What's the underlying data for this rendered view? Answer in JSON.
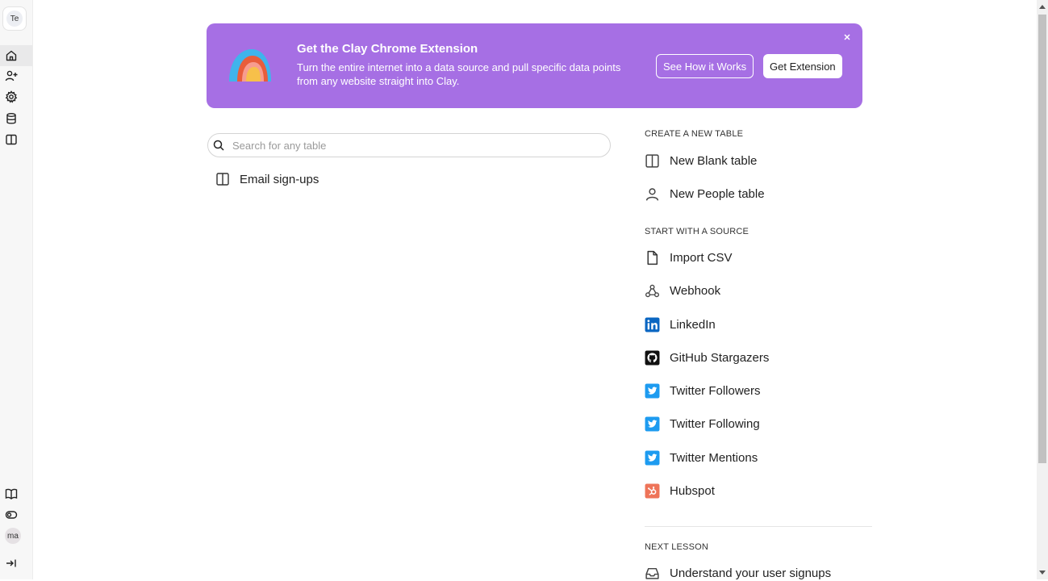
{
  "workspace": {
    "initials": "Te"
  },
  "user": {
    "initials": "ma"
  },
  "sidebar": {
    "top_items": [
      {
        "icon": "home-icon",
        "active": true
      },
      {
        "icon": "add-user-icon"
      },
      {
        "icon": "gear-icon"
      },
      {
        "icon": "database-icon"
      },
      {
        "icon": "book-open-icon"
      }
    ],
    "bottom_items": [
      {
        "icon": "book-icon"
      },
      {
        "icon": "toggle-icon"
      }
    ]
  },
  "banner": {
    "title": "Get the Clay Chrome Extension",
    "description": "Turn the entire internet into a data source and pull specific data points from any website straight into Clay.",
    "how_button": "See How it Works",
    "get_button": "Get Extension",
    "bg_color": "#a66fe4"
  },
  "search": {
    "placeholder": "Search for any table",
    "value": ""
  },
  "tables": [
    {
      "name": "Email sign-ups"
    }
  ],
  "create_section": {
    "heading": "CREATE A NEW TABLE",
    "items": [
      {
        "label": "New Blank table",
        "icon": "table-icon"
      },
      {
        "label": "New People table",
        "icon": "person-icon"
      }
    ]
  },
  "source_section": {
    "heading": "START WITH A SOURCE",
    "items": [
      {
        "label": "Import CSV",
        "icon": "file-icon"
      },
      {
        "label": "Webhook",
        "icon": "webhook-icon"
      },
      {
        "label": "LinkedIn",
        "icon": "linkedin-icon"
      },
      {
        "label": "GitHub Stargazers",
        "icon": "github-icon"
      },
      {
        "label": "Twitter Followers",
        "icon": "twitter-icon"
      },
      {
        "label": "Twitter Following",
        "icon": "twitter-icon"
      },
      {
        "label": "Twitter Mentions",
        "icon": "twitter-icon"
      },
      {
        "label": "Hubspot",
        "icon": "hubspot-icon"
      }
    ]
  },
  "lesson_section": {
    "heading": "NEXT LESSON",
    "items": [
      {
        "label": "Understand your user signups",
        "icon": "inbox-icon"
      }
    ]
  }
}
